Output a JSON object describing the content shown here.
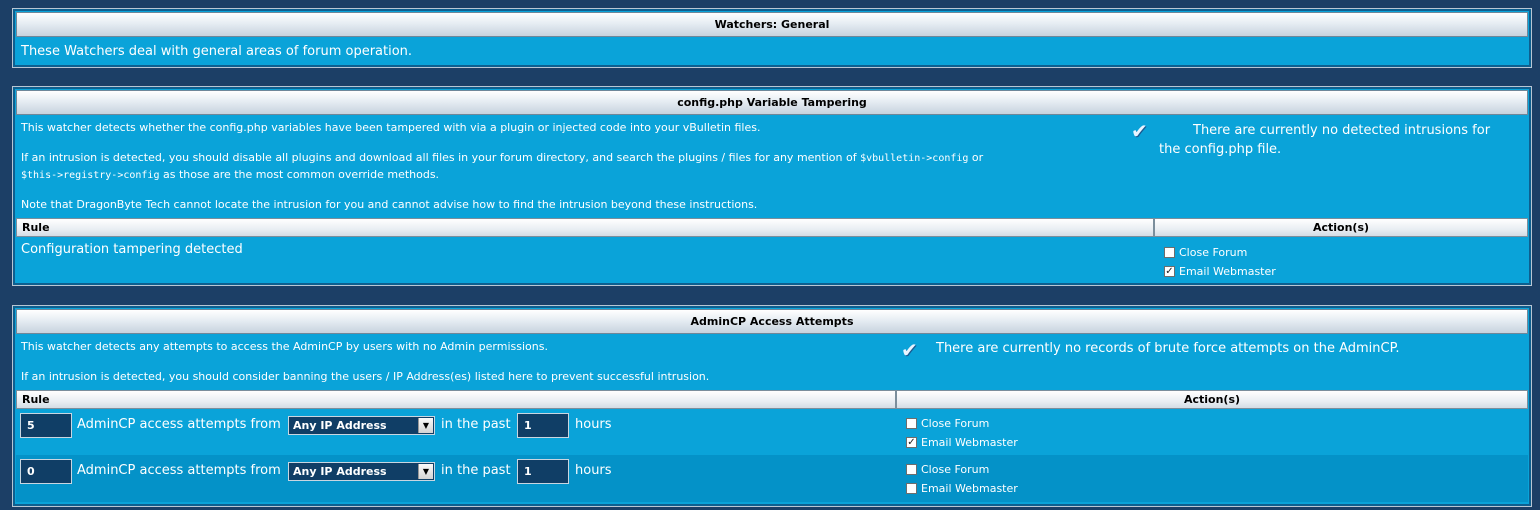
{
  "general": {
    "title": "Watchers: General",
    "description": "These Watchers deal with general areas of forum operation."
  },
  "config": {
    "title": "config.php Variable Tampering",
    "desc1": "This watcher detects whether the config.php variables have been tampered with via a plugin or injected code into your vBulletin files.",
    "desc2_pre": "If an intrusion is detected, you should disable all plugins and download all files in your forum directory, and search the plugins / files for any mention of ",
    "code1": "$vbulletin->config",
    "desc2_or": " or",
    "code2": "$this->registry->config",
    "desc2_post": " as those are the most common override methods.",
    "desc3": "Note that DragonByte Tech cannot locate the intrusion for you and cannot advise how to find the intrusion beyond these instructions.",
    "status": "There are currently no detected intrusions for the config.php file.",
    "col_rule": "Rule",
    "col_actions": "Action(s)",
    "rule": "Configuration tampering detected",
    "close_forum": "Close Forum",
    "email_webmaster": "Email Webmaster",
    "close_forum_checked": false,
    "email_webmaster_checked": true
  },
  "admincp": {
    "title": "AdminCP Access Attempts",
    "desc1": "This watcher detects any attempts to access the AdminCP by users with no Admin permissions.",
    "desc2": "If an intrusion is detected, you should consider banning the users / IP Address(es) listed here to prevent successful intrusion.",
    "status": "There are currently no records of brute force attempts on the AdminCP.",
    "col_rule": "Rule",
    "col_actions": "Action(s)",
    "text_attempts": "AdminCP access attempts from",
    "text_past": "in the past",
    "text_hours": "hours",
    "rows": [
      {
        "count": "5",
        "ip": "Any IP Address",
        "hours": "1",
        "close_forum": "Close Forum",
        "email_webmaster": "Email Webmaster",
        "close_forum_checked": false,
        "email_webmaster_checked": true
      },
      {
        "count": "0",
        "ip": "Any IP Address",
        "hours": "1",
        "close_forum": "Close Forum",
        "email_webmaster": "Email Webmaster",
        "close_forum_checked": false,
        "email_webmaster_checked": false
      }
    ]
  }
}
